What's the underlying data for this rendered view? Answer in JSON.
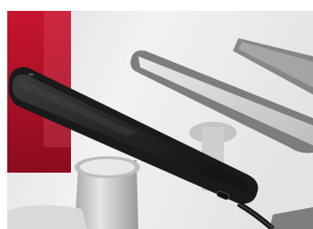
{
  "photo": {
    "subject": "smartphones-on-retail-security-display-stands",
    "colors": {
      "frame": "#ffffff",
      "background": "#ebebeb",
      "accent": "#b8112a",
      "device_body": "#1b1b1d",
      "device_screen": "#2a2a2c",
      "stand": "#cfcfcf"
    }
  }
}
